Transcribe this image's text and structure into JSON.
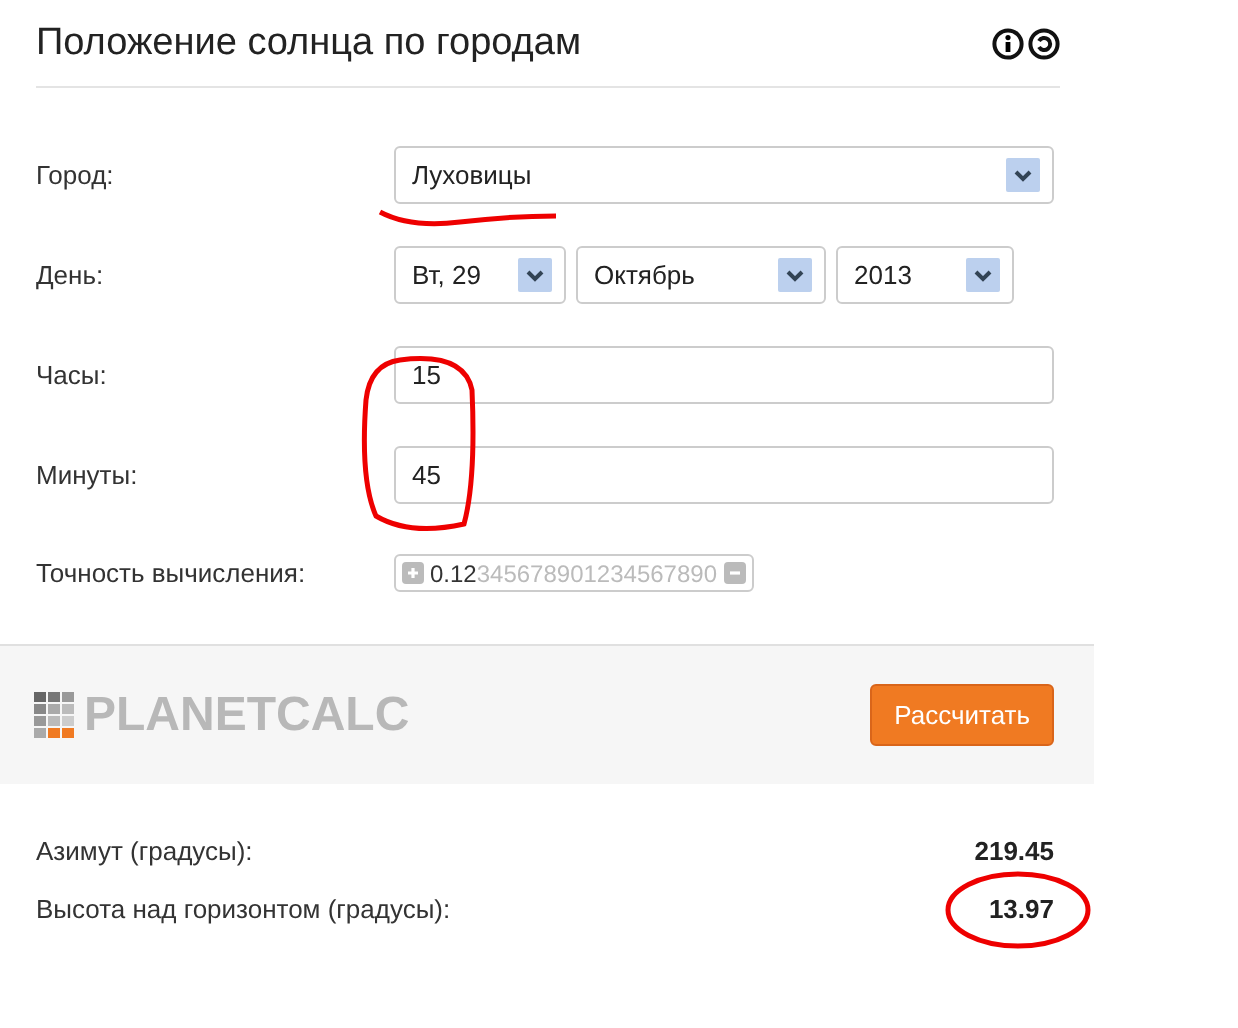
{
  "title": "Положение солнца по городам",
  "fields": [
    {
      "label": "Город:",
      "kind": "select",
      "parts": [
        {
          "value": "Луховицы"
        }
      ]
    },
    {
      "label": "День:",
      "kind": "select",
      "parts": [
        {
          "value": "Вт, 29"
        },
        {
          "value": "Октябрь"
        },
        {
          "value": "2013"
        }
      ]
    },
    {
      "label": "Часы:",
      "kind": "input",
      "value": "15"
    },
    {
      "label": "Минуты:",
      "kind": "input",
      "value": "45"
    },
    {
      "label": "Точность вычисления:",
      "kind": "precision",
      "value": "0.12",
      "rest": "345678901234567890"
    }
  ],
  "logo": "PLANETCALC",
  "button": "Рассчитать",
  "results": [
    {
      "label": "Азимут (градусы):",
      "value": "219.45"
    },
    {
      "label": "Высота над горизонтом (градусы):",
      "value": "13.97"
    }
  ]
}
